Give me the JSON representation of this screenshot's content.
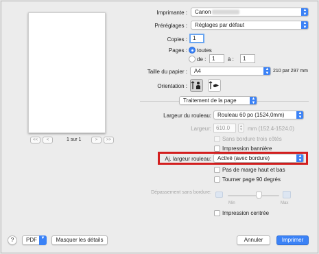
{
  "preview": {
    "page_label": "1 sur 1",
    "first_btn": "<<",
    "prev_btn": "<",
    "next_btn": ">",
    "last_btn": ">>"
  },
  "printer": {
    "label": "Imprimante :",
    "value": "Canon"
  },
  "presets": {
    "label": "Préréglages :",
    "value": "Réglages par défaut"
  },
  "copies": {
    "label": "Copies :",
    "value": "1"
  },
  "pages": {
    "label": "Pages :",
    "all_label": "toutes",
    "from_label": "de :",
    "from_value": "1",
    "to_label": "à :",
    "to_value": "1"
  },
  "paper_size": {
    "label": "Taille du papier :",
    "value": "A4",
    "dimensions": "210 par 297 mm"
  },
  "orientation": {
    "label": "Orientation :"
  },
  "section_popup": {
    "value": "Traitement de la page"
  },
  "roll_width": {
    "label": "Largeur du rouleau:",
    "value": "Rouleau 60 po (1524,0mm)"
  },
  "width": {
    "label": "Largeur:",
    "value": "610.0",
    "range": "mm (152.4-1524.0)"
  },
  "options": {
    "three_side_borderless": "Sans bordure trois côtés",
    "banner_printing": "Impression bannière"
  },
  "fit_roll_width": {
    "label": "Aj. largeur rouleau:",
    "value": "Activé (avec bordure)"
  },
  "options2": {
    "no_top_bottom_margin": "Pas de marge haut et bas",
    "rotate_90": "Tourner page 90 degrés"
  },
  "overflow": {
    "label": "Dépassement sans bordure:",
    "min_label": "Min",
    "max_label": "Max",
    "slider_level": 0.6
  },
  "centered": {
    "label": "Impression centrée"
  },
  "footer": {
    "help": "?",
    "pdf": "PDF",
    "hide_details": "Masquer les détails",
    "cancel": "Annuler",
    "print": "Imprimer"
  },
  "colors": {
    "accent": "#3b82f6",
    "highlight_border": "#d31f1f"
  }
}
